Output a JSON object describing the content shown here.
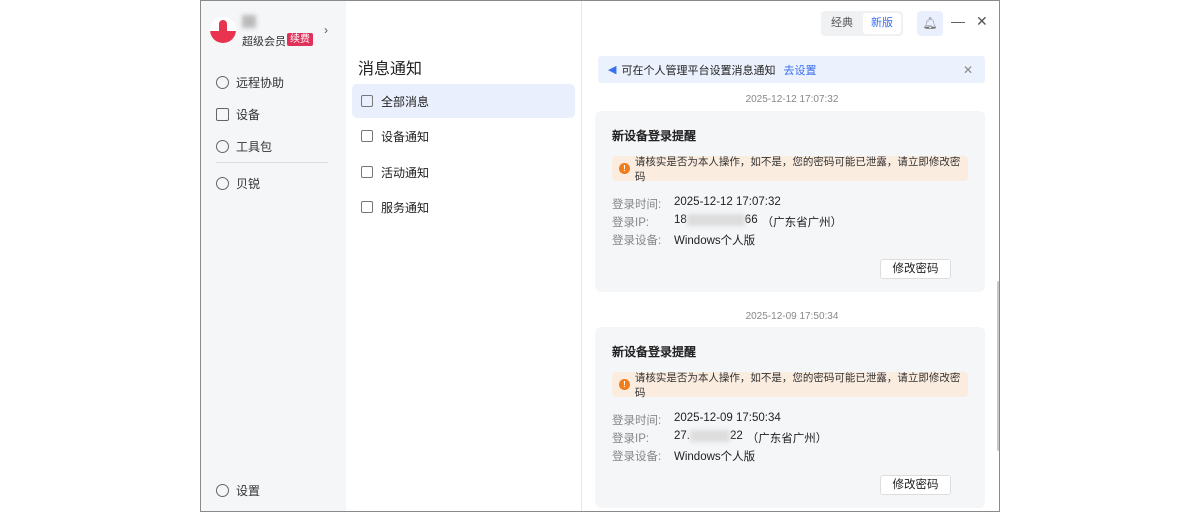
{
  "sidebar": {
    "level": "超级会员",
    "renew": "续费",
    "items": [
      {
        "label": "远程协助"
      },
      {
        "label": "设备"
      },
      {
        "label": "工具包"
      },
      {
        "label": "贝锐"
      }
    ],
    "settings": "设置"
  },
  "middle": {
    "title": "消息通知",
    "items": [
      {
        "label": "全部消息"
      },
      {
        "label": "设备通知"
      },
      {
        "label": "活动通知"
      },
      {
        "label": "服务通知"
      }
    ]
  },
  "topbar": {
    "classic": "经典",
    "new": "新版"
  },
  "banner": {
    "text": "可在个人管理平台设置消息通知",
    "link": "去设置"
  },
  "labels": {
    "time": "登录时间:",
    "ip": "登录IP:",
    "device": "登录设备:"
  },
  "messages": [
    {
      "timestamp": "2025-12-12 17:07:32",
      "title": "新设备登录提醒",
      "warning": "请核实是否为本人操作，如不是，您的密码可能已泄露，请立即修改密码",
      "time": "2025-12-12 17:07:32",
      "ip_prefix": "18",
      "ip_suffix": "66",
      "location": "（广东省广州）",
      "device": "Windows个人版",
      "button": "修改密码"
    },
    {
      "timestamp": "2025-12-09 17:50:34",
      "title": "新设备登录提醒",
      "warning": "请核实是否为本人操作，如不是，您的密码可能已泄露，请立即修改密码",
      "time": "2025-12-09 17:50:34",
      "ip_prefix": "27.",
      "ip_suffix": "22",
      "location": "（广东省广州）",
      "device": "Windows个人版",
      "button": "修改密码"
    }
  ]
}
